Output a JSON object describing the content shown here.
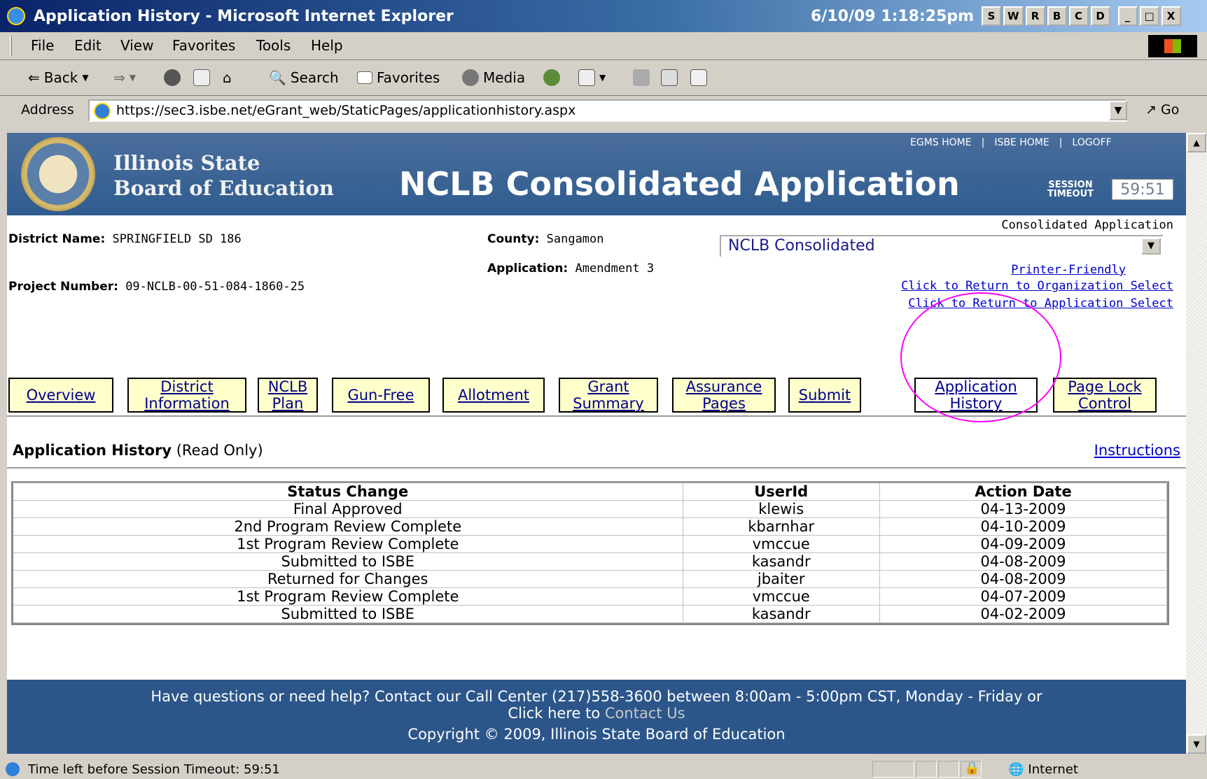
{
  "window": {
    "title": "Application History - Microsoft Internet Explorer",
    "clock": "6/10/09 1:18:25pm",
    "tray_buttons": [
      "S",
      "W",
      "R",
      "B",
      "C",
      "D"
    ],
    "controls": [
      "_",
      "□",
      "X"
    ]
  },
  "menu": [
    "File",
    "Edit",
    "View",
    "Favorites",
    "Tools",
    "Help"
  ],
  "toolbar": {
    "back": "Back",
    "search": "Search",
    "favorites": "Favorites",
    "media": "Media"
  },
  "address": {
    "label": "Address",
    "url": "https://sec3.isbe.net/eGrant_web/StaticPages/applicationhistory.aspx",
    "go": "Go"
  },
  "banner": {
    "org_line1": "Illinois State",
    "org_line2": "Board of Education",
    "app_title": "NCLB Consolidated Application",
    "links": [
      "EGMS HOME",
      "|",
      "ISBE HOME",
      "|",
      "LOGOFF"
    ],
    "session_label_1": "SESSION",
    "session_label_2": "TIMEOUT",
    "session_timer": "59:51"
  },
  "info": {
    "district_label": "District Name:",
    "district_value": "SPRINGFIELD SD 186",
    "county_label": "County:",
    "county_value": "Sangamon",
    "application_label": "Application:",
    "application_value": "Amendment 3",
    "project_label": "Project Number:",
    "project_value": "09-NCLB-00-51-084-1860-25",
    "select_caption": "Consolidated Application",
    "select_value": "NCLB Consolidated",
    "printer_link": "Printer-Friendly",
    "return_org_link": "Click to Return to Organization Select",
    "return_app_link": "Click to Return to Application Select"
  },
  "tabs": [
    {
      "label": "Overview"
    },
    {
      "label": "District\nInformation"
    },
    {
      "label": "NCLB\nPlan"
    },
    {
      "label": "Gun-Free"
    },
    {
      "label": "Allotment"
    },
    {
      "label": "Grant\nSummary"
    },
    {
      "label": "Assurance\nPages"
    },
    {
      "label": "Submit"
    },
    {
      "label": "Application\nHistory"
    },
    {
      "label": "Page Lock\nControl"
    }
  ],
  "section": {
    "title": "Application History",
    "subtitle": "(Read Only)",
    "instructions": "Instructions"
  },
  "history_table": {
    "headers": [
      "Status Change",
      "UserId",
      "Action Date"
    ],
    "rows": [
      [
        "Final Approved",
        "klewis",
        "04-13-2009"
      ],
      [
        "2nd Program Review Complete",
        "kbarnhar",
        "04-10-2009"
      ],
      [
        "1st Program Review Complete",
        "vmccue",
        "04-09-2009"
      ],
      [
        "Submitted to ISBE",
        "kasandr",
        "04-08-2009"
      ],
      [
        "Returned for Changes",
        "jbaiter",
        "04-08-2009"
      ],
      [
        "1st Program Review Complete",
        "vmccue",
        "04-07-2009"
      ],
      [
        "Submitted to ISBE",
        "kasandr",
        "04-02-2009"
      ]
    ]
  },
  "footer": {
    "line1": "Have questions or need help? Contact our Call Center (217)558-3600 between 8:00am - 5:00pm CST, Monday - Friday or",
    "line2_prefix": "Click here to",
    "line2_link": "Contact Us",
    "copyright": "Copyright © 2009, Illinois State Board of Education"
  },
  "status": {
    "text": "Time left before Session Timeout: 59:51",
    "zone": "Internet"
  }
}
